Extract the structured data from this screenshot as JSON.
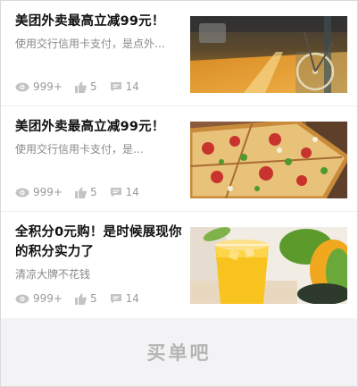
{
  "feed": {
    "cards": [
      {
        "title": "美团外卖最高立减99元！",
        "desc": "使用交行信用卡支付，是点外…",
        "views": "999+",
        "likes": "5",
        "comments": "14",
        "thumb_icon": "street-bicycle-photo"
      },
      {
        "title": "美团外卖最高立减99元！",
        "desc": "使用交行信用卡支付，是…",
        "views": "999+",
        "likes": "5",
        "comments": "14",
        "thumb_icon": "pizza-photo"
      },
      {
        "title": "全积分0元购！是时候展现你的积分实力了",
        "desc": "清凉大牌不花钱",
        "views": "999+",
        "likes": "5",
        "comments": "14",
        "thumb_icon": "mango-juice-photo"
      }
    ]
  },
  "footer": {
    "button_label": "买单吧"
  },
  "colors": {
    "meta_icon": "#bfbfbf",
    "footer_bg": "#f3f3f5",
    "footer_text": "#b5b5b5"
  }
}
